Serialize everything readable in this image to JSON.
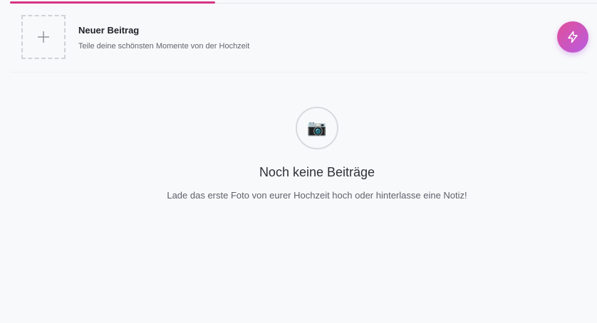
{
  "composer": {
    "title": "Neuer Beitrag",
    "subtitle": "Teile deine schönsten Momente von der Hochzeit",
    "add_icon": "plus-icon"
  },
  "fab": {
    "icon": "lightning-icon"
  },
  "empty_state": {
    "icon": "camera-icon",
    "icon_glyph": "📷",
    "title": "Noch keine Beiträge",
    "message": "Lade das erste Foto von eurer Hochzeit hoch oder hinterlasse eine Notiz!"
  },
  "colors": {
    "accent": "#d63384",
    "fab_gradient_start": "#e14f9a",
    "fab_gradient_end": "#b85ce0"
  }
}
